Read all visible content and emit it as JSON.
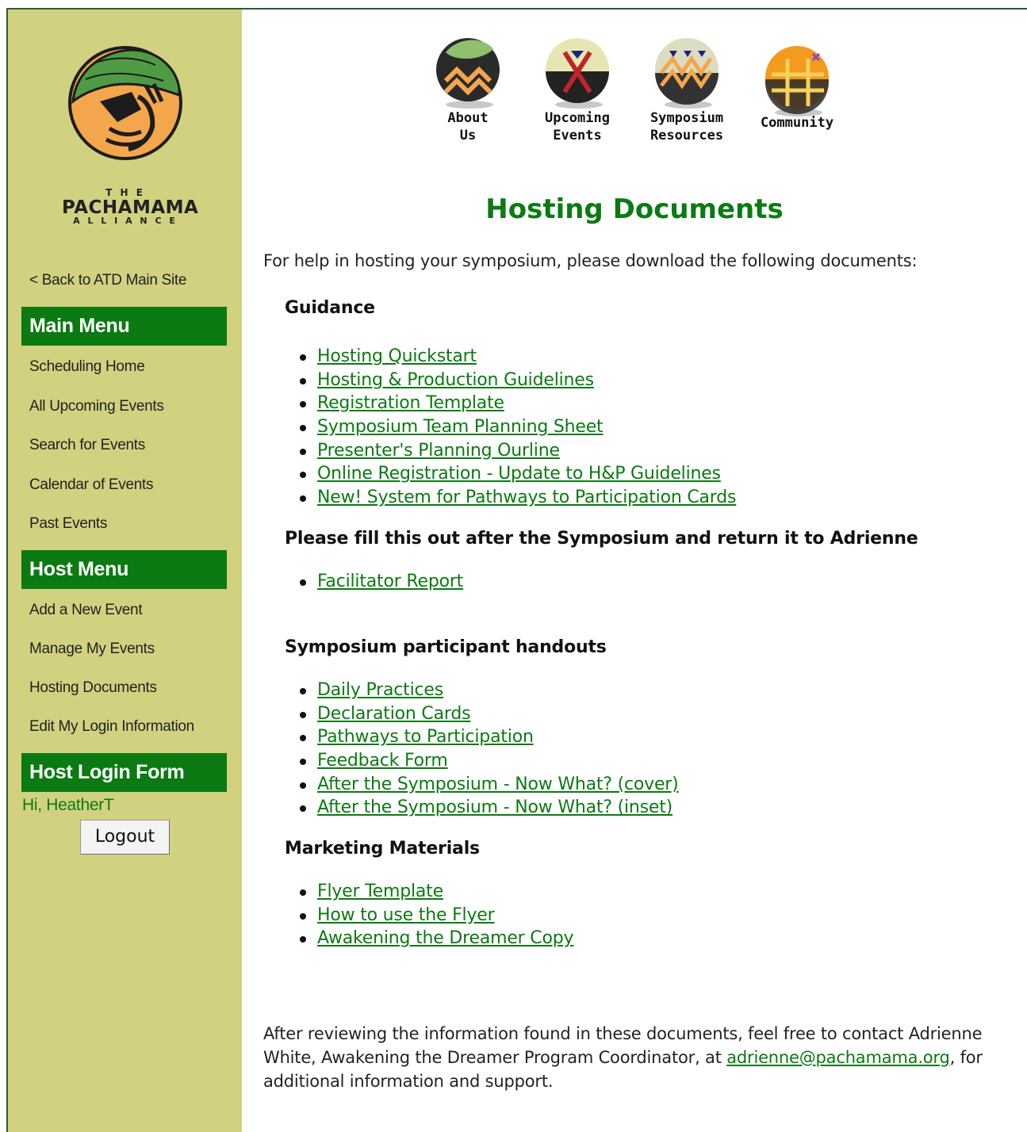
{
  "brand": {
    "logo_the": "T H E",
    "logo_name": "PACHAMAMA",
    "logo_alliance": "A L L I A N C E"
  },
  "sidebar": {
    "back_link": "< Back to ATD Main Site",
    "main_menu": {
      "heading": "Main Menu",
      "items": [
        "Scheduling Home",
        "All Upcoming Events",
        "Search for Events",
        "Calendar of Events",
        "Past Events"
      ]
    },
    "host_menu": {
      "heading": "Host Menu",
      "items": [
        "Add a New Event",
        "Manage My Events",
        "Hosting Documents",
        "Edit My Login Information"
      ]
    },
    "login": {
      "heading": "Host Login Form",
      "greeting": "Hi, HeatherT",
      "logout_label": "Logout"
    }
  },
  "nav": {
    "items": [
      {
        "label": "About\nUs",
        "icon": "about-us-icon"
      },
      {
        "label": "Upcoming\nEvents",
        "icon": "upcoming-events-icon"
      },
      {
        "label": "Symposium\nResources",
        "icon": "symposium-resources-icon"
      },
      {
        "label": "Community",
        "icon": "community-icon"
      }
    ]
  },
  "main": {
    "title": "Hosting Documents",
    "intro": "For help in hosting your symposium, please download the following documents:",
    "sections": [
      {
        "heading": "Guidance",
        "links": [
          "Hosting Quickstart",
          "Hosting & Production Guidelines",
          "Registration Template",
          "Symposium Team Planning Sheet",
          "Presenter's Planning Ourline",
          "Online Registration - Update to H&P Guidelines",
          "New! System for Pathways to Participation Cards"
        ]
      },
      {
        "heading": "Please fill this out after the Symposium and return it to Adrienne",
        "links": [
          "Facilitator Report"
        ]
      },
      {
        "heading": "Symposium participant handouts",
        "links": [
          "Daily Practices",
          "Declaration Cards",
          "Pathways to Participation",
          "Feedback Form",
          "After the Symposium - Now What? (cover)",
          "After the Symposium - Now What? (inset)"
        ]
      },
      {
        "heading": "Marketing Materials",
        "links": [
          "Flyer Template",
          "How to use the Flyer",
          "Awakening the Dreamer Copy"
        ]
      }
    ],
    "outro_before": "After reviewing the information found in these documents, feel free to contact Adrienne White, Awakening the Dreamer Program Coordinator, at ",
    "outro_email": "adrienne@pachamama.org",
    "outro_after": ", for additional information and support."
  },
  "colors": {
    "sidebar_bg": "#d2d180",
    "menu_green": "#0b7a12",
    "link_green": "#0b7a12"
  }
}
